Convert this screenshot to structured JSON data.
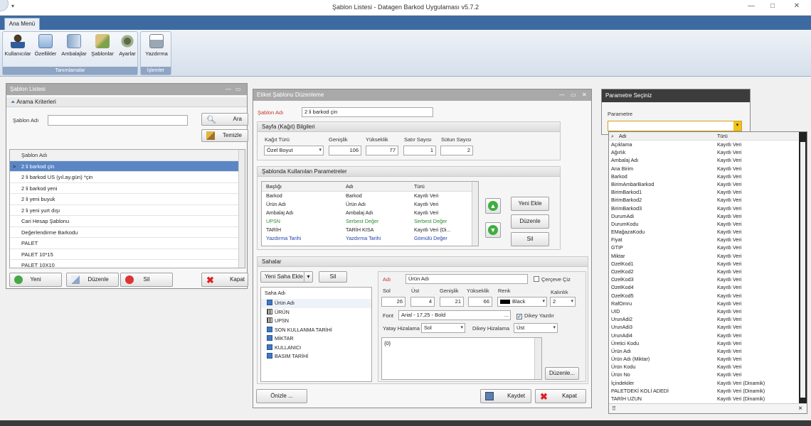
{
  "window": {
    "title": "Şablon Listesi - Datagen Barkod Uygulaması v5.7.2",
    "minimize": "—",
    "maximize": "□",
    "close": "✕"
  },
  "ribbon": {
    "tab": "Ana Menü",
    "groups": [
      {
        "caption": "Tanımlamalar",
        "buttons": [
          "Kullanıcılar",
          "Özellikler",
          "Ambalajlar",
          "Şablonlar",
          "Ayarlar"
        ]
      },
      {
        "caption": "İşlemler",
        "buttons": [
          "Yazdırma"
        ]
      }
    ]
  },
  "template_list": {
    "title": "Şablon Listesi",
    "criteria": "Arama Kriterleri",
    "name_label": "Şablon Adı",
    "name_value": "",
    "search_btn": "Ara",
    "clear_btn": "Temizle",
    "column": "Şablon Adı",
    "items": [
      "2 li barkod çin",
      "2 li barkod US (yıl.ay.gün) *çin",
      "2 li barkod yeni",
      "2 li yeni buyuk",
      "2 li yeni yurt dışı",
      "Cari Hesap Şablonu",
      "Değerlendirme Barkodu",
      "PALET",
      "PALET 10*15",
      "PALET 10X10"
    ],
    "new_btn": "Yeni",
    "edit_btn": "Düzenle",
    "delete_btn": "Sil",
    "close_btn": "Kapat"
  },
  "editor": {
    "title": "Etiket Şablonu Düzenleme",
    "name_label": "Şablon Adı",
    "name_value": "2 li barkod çin",
    "page_group": "Sayfa (Kağıt) Bilgileri",
    "paper_label": "Kağıt Türü",
    "paper_value": "Özel Boyut",
    "width_label": "Genişlik",
    "width_value": "106",
    "height_label": "Yükseklik",
    "height_value": "77",
    "rows_label": "Satır Sayısı",
    "rows_value": "1",
    "cols_label": "Sütun Sayısı",
    "cols_value": "2",
    "params_group": "Şablonda Kullanılan Parametreler",
    "param_headers": [
      "Başlığı",
      "Adı",
      "Türü"
    ],
    "params": [
      {
        "title": "Barkod",
        "name": "Barkod",
        "type": "Kayıtlı Veri",
        "color": "#222222"
      },
      {
        "title": "Ürün Adı",
        "name": "Ürün Adı",
        "type": "Kayıtlı Veri",
        "color": "#222222"
      },
      {
        "title": "Ambalaj Adı",
        "name": "Ambalaj Adı",
        "type": "Kayıtlı Veri",
        "color": "#222222"
      },
      {
        "title": "UPSN",
        "name": "Serbest Değer",
        "type": "Serbest Değer",
        "color": "#2e8b2e"
      },
      {
        "title": "TARİH",
        "name": "TARİH KISA",
        "type": "Kayıtlı Veri (Di...",
        "color": "#222222"
      },
      {
        "title": "Yazdırma Tarihi",
        "name": "Yazdırma Tarihi",
        "type": "Gömülü Değer",
        "color": "#1f3fa8"
      }
    ],
    "add_new_btn": "Yeni Ekle",
    "edit_btn": "Düzenle",
    "delete_btn": "Sil",
    "fields_group": "Sahalar",
    "new_field_btn": "Yeni Saha Ekle",
    "field_delete_btn": "Sil",
    "field_name_header": "Saha Adı",
    "fields": [
      {
        "name": "Ürün Adı",
        "kind": "text"
      },
      {
        "name": "ÜRÜN",
        "kind": "barcode"
      },
      {
        "name": "UPSN",
        "kind": "barcode"
      },
      {
        "name": "SON KULLANMA TARİHİ",
        "kind": "text"
      },
      {
        "name": "MİKTAR",
        "kind": "text"
      },
      {
        "name": "KULLANICI",
        "kind": "text"
      },
      {
        "name": "BASIM TARİHİ",
        "kind": "text"
      }
    ],
    "prop_name_label": "Adı",
    "prop_name_value": "Ürün Adı",
    "frame_label": "Çerçeve Çiz",
    "left_label": "Sol",
    "left_value": "26",
    "top_label": "Üst",
    "top_value": "4",
    "pwidth_label": "Genişlik",
    "pwidth_value": "21",
    "pheight_label": "Yükseklik",
    "pheight_value": "66",
    "color_label": "Renk",
    "color_value": "Black",
    "thickness_label": "Kalınlık",
    "thickness_value": "2",
    "font_label": "Font",
    "font_value": "Arial - 17,25 - Bold",
    "font_browse": "...",
    "vertical_label": "Dikey Yazdır",
    "halign_label": "Yatay Hizalama",
    "halign_value": "Sol",
    "valign_label": "Dikey Hizalama",
    "valign_value": "Üst",
    "content_value": "{0}",
    "content_edit_btn": "Düzenle...",
    "preview_btn": "Önizle ...",
    "save_btn": "Kaydet",
    "close_btn": "Kapat"
  },
  "param_selector": {
    "title": "Parametre Seçiniz",
    "label": "Parametre",
    "value": "",
    "col_name": "Adı",
    "col_type": "Türü",
    "items": [
      [
        "Açıklama",
        "Kayıtlı Veri"
      ],
      [
        "Ağırlık",
        "Kayıtlı Veri"
      ],
      [
        "Ambalaj Adı",
        "Kayıtlı Veri"
      ],
      [
        "Ana Birim",
        "Kayıtlı Veri"
      ],
      [
        "Barkod",
        "Kayıtlı Veri"
      ],
      [
        "BirimAmbarBarkod",
        "Kayıtlı Veri"
      ],
      [
        "BirimBarkod1",
        "Kayıtlı Veri"
      ],
      [
        "BirimBarkod2",
        "Kayıtlı Veri"
      ],
      [
        "BirimBarkod3",
        "Kayıtlı Veri"
      ],
      [
        "DurumAdi",
        "Kayıtlı Veri"
      ],
      [
        "DurumKodu",
        "Kayıtlı Veri"
      ],
      [
        "EMağazaKodu",
        "Kayıtlı Veri"
      ],
      [
        "Fiyat",
        "Kayıtlı Veri"
      ],
      [
        "GTIP",
        "Kayıtlı Veri"
      ],
      [
        "Miktar",
        "Kayıtlı Veri"
      ],
      [
        "OzelKod1",
        "Kayıtlı Veri"
      ],
      [
        "OzelKod2",
        "Kayıtlı Veri"
      ],
      [
        "OzelKod3",
        "Kayıtlı Veri"
      ],
      [
        "OzelKod4",
        "Kayıtlı Veri"
      ],
      [
        "OzelKod5",
        "Kayıtlı Veri"
      ],
      [
        "RafOmru",
        "Kayıtlı Veri"
      ],
      [
        "UID",
        "Kayıtlı Veri"
      ],
      [
        "UrunAdi2",
        "Kayıtlı Veri"
      ],
      [
        "UrunAdi3",
        "Kayıtlı Veri"
      ],
      [
        "UrunAdi4",
        "Kayıtlı Veri"
      ],
      [
        "Üretici Kodu",
        "Kayıtlı Veri"
      ],
      [
        "Ürün Adı",
        "Kayıtlı Veri"
      ],
      [
        "Ürün Adı (Miktar)",
        "Kayıtlı Veri"
      ],
      [
        "Ürün Kodu",
        "Kayıtlı Veri"
      ],
      [
        "Ürün No",
        "Kayıtlı Veri"
      ],
      [
        "İçindekiler",
        "Kayıtlı Veri (Dinamik)"
      ],
      [
        "PALETDEKİ KOLİ ADEDİ",
        "Kayıtlı Veri (Dinamik)"
      ],
      [
        "TARİH UZUN",
        "Kayıtlı Veri (Dinamik)"
      ]
    ],
    "footer": "⠿",
    "close": "×"
  },
  "colors": {
    "accent": "#3d6aa0",
    "selection": "#5b86c5",
    "panel_header_gray": "#a9a9a9",
    "dark_header": "#3c3c3c"
  }
}
